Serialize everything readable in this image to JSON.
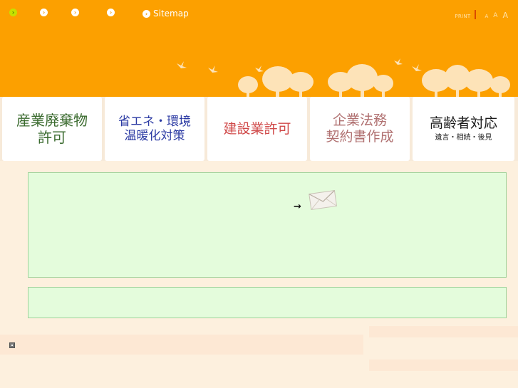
{
  "header": {
    "nav": [
      {
        "label": "",
        "icon": "arrow-circle-icon"
      },
      {
        "label": "",
        "icon": "arrow-circle-icon"
      },
      {
        "label": "",
        "icon": "arrow-circle-icon"
      },
      {
        "label": "",
        "icon": "arrow-circle-icon"
      },
      {
        "label": "Sitemap",
        "icon": "arrow-circle-icon"
      }
    ],
    "tools": {
      "print": "PRINT",
      "font_small": "A",
      "font_medium": "A",
      "font_large": "A"
    }
  },
  "categories": [
    {
      "line1": "産業廃棄物",
      "line2": "許可"
    },
    {
      "line1": "省エネ・環境",
      "line2": "温暖化対策"
    },
    {
      "line1": "建設業許可"
    },
    {
      "line1": "企業法務",
      "line2": "契約書作成"
    },
    {
      "line1": "高齢者対応",
      "line2": "遺言・相続・後見"
    }
  ],
  "contact": {
    "arrow": "→",
    "icon": "envelope-icon"
  },
  "colors": {
    "header_bg": "#fca000",
    "page_bg": "#fdf0de",
    "box_bg": "#e4fcdc",
    "box_border": "#9fd29a"
  }
}
